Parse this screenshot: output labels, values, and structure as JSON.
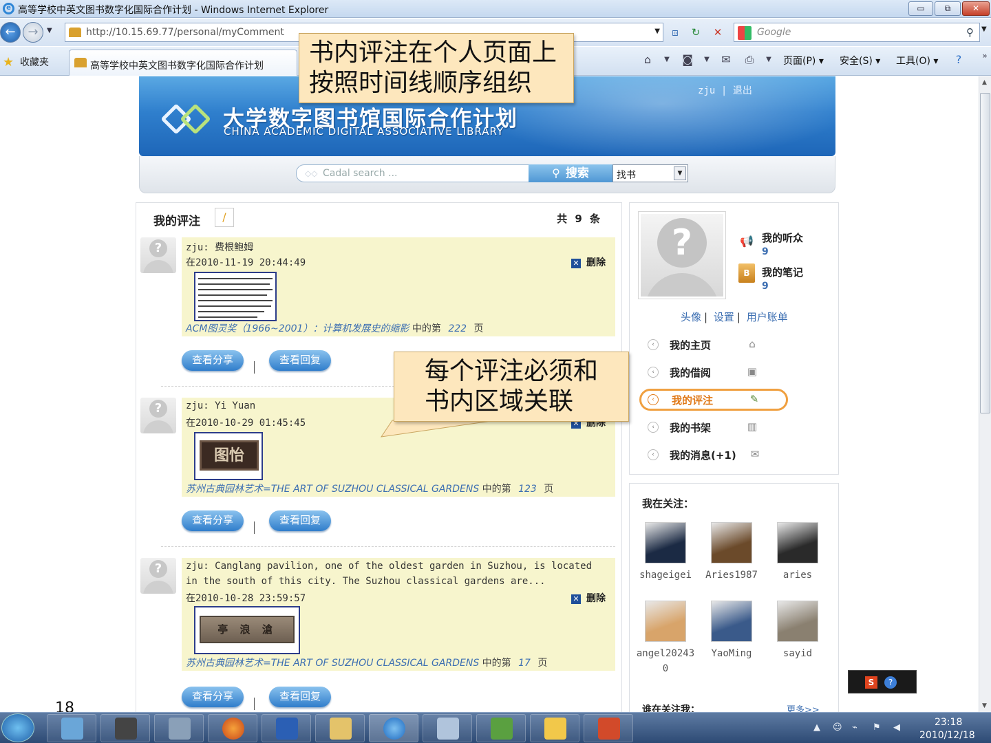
{
  "window": {
    "title": "高等学校中英文图书数字化国际合作计划 - Windows Internet Explorer",
    "min": "▭",
    "max": "⧉",
    "close": "✕"
  },
  "browser": {
    "url": "http://10.15.69.77/personal/myComment",
    "search_placeholder": "Google",
    "favorites_label": "收藏夹",
    "tab_title": "高等学校中英文图书数字化国际合作计划",
    "page_menu": "页面(P) ▾",
    "safety_menu": "安全(S) ▾",
    "tools_menu": "工具(O) ▾"
  },
  "site": {
    "name_cn": "大学数字图书馆国际合作计划",
    "name_en": "CHINA ACADEMIC DIGITAL ASSOCIATIVE LIBRARY",
    "user": "zju",
    "divider": "|",
    "logout": "退出",
    "search_placeholder": "Cadal search ...",
    "search_button": "搜索",
    "search_type": "找书"
  },
  "comments_panel": {
    "title": "我的评注",
    "count": "共 9 条",
    "view_share": "查看分享",
    "view_reply": "查看回复",
    "delete": "删除",
    "page_prefix": "中的第",
    "page_suffix": "页",
    "items": [
      {
        "user_line": "zju: 费根鲍姆",
        "time": "在2010-11-19 20:44:49",
        "book_title": "ACM图灵奖（1966~2001）：计算机发展史的缩影",
        "page": "222",
        "has_delete": true
      },
      {
        "user_line": "zju: Yi Yuan",
        "time": "在2010-10-29 01:45:45",
        "book_title": "苏州古典园林艺术=THE ART OF SUZHOU CLASSICAL GARDENS",
        "page": "123",
        "has_delete": true,
        "thumb_text": "图怡"
      },
      {
        "user_line": "zju: Canglang pavilion, one of the oldest garden in Suzhou, is located",
        "user_line2": "in the south of this city. The Suzhou classical gardens are...",
        "time": "在2010-10-28 23:59:57",
        "book_title": "苏州古典园林艺术=THE ART OF SUZHOU CLASSICAL GARDENS",
        "page": "17",
        "has_delete": true,
        "thumb_text": "亭 浪 滄"
      }
    ]
  },
  "profile": {
    "listeners_label": "我的听众",
    "listeners_count": "9",
    "notes_label": "我的笔记",
    "notes_count": "9",
    "links": [
      "头像",
      "设置",
      "用户账单"
    ],
    "menu": [
      {
        "label": "我的主页",
        "icon": "home-icon",
        "glyph": "⌂"
      },
      {
        "label": "我的借阅",
        "icon": "borrow-icon",
        "glyph": "▣"
      },
      {
        "label": "我的评注",
        "icon": "comment-edit-icon",
        "glyph": "✎",
        "active": true
      },
      {
        "label": "我的书架",
        "icon": "bookshelf-icon",
        "glyph": "▥"
      },
      {
        "label": "我的消息(+1)",
        "icon": "message-icon",
        "glyph": "✉"
      }
    ]
  },
  "following": {
    "title": "我在关注：",
    "friends": [
      {
        "name": "shageigei",
        "color": "#1b2a44"
      },
      {
        "name": "Aries1987",
        "color": "#6b4a2a"
      },
      {
        "name": "aries",
        "color": "#2a2a2a"
      },
      {
        "name": "angel202430",
        "color": "#d8a46a"
      },
      {
        "name": "YaoMing",
        "color": "#3a5a8a"
      },
      {
        "name": "sayid",
        "color": "#8a8070"
      }
    ],
    "who_follows": "谁在关注我：",
    "more": "更多>>"
  },
  "callouts": {
    "c1_line1": "书内评注在个人页面上",
    "c1_line2": "按照时间线顺序组织",
    "c2_line1": "每个评注必须和",
    "c2_line2": "书内区域关联"
  },
  "slide_number": "18",
  "taskbar": {
    "time": "23:18",
    "date": "2010/12/18"
  }
}
